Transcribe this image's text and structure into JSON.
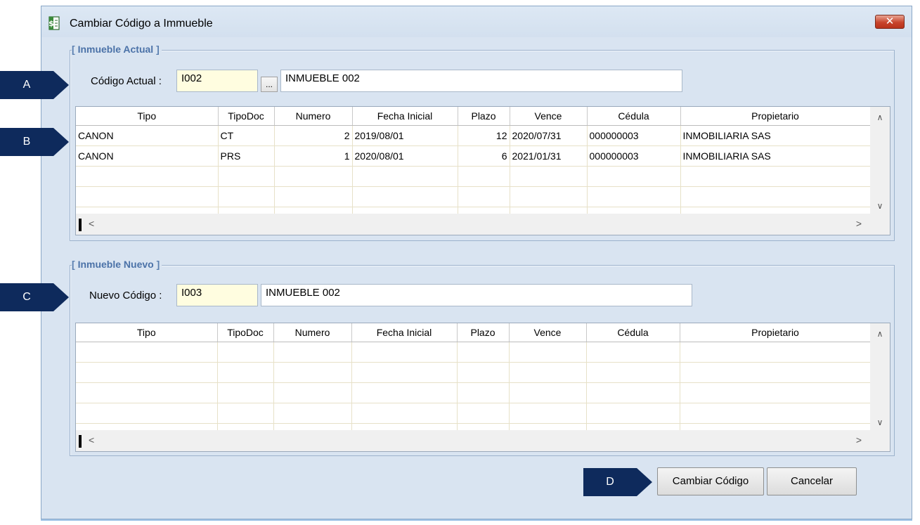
{
  "window": {
    "title": "Cambiar Código a Immueble",
    "close_glyph": "✕",
    "icon": "document-dollar-icon"
  },
  "current": {
    "group_title": "Inmueble Actual",
    "code_label": "Código Actual :",
    "code_value": "I002",
    "lookup_button": "...",
    "name_value": "INMUEBLE 002"
  },
  "new": {
    "group_title": "Inmueble Nuevo",
    "code_label": "Nuevo Código :",
    "code_value": "I003",
    "name_value": "INMUEBLE 002"
  },
  "grid_columns": [
    "Tipo",
    "TipoDoc",
    "Numero",
    "Fecha Inicial",
    "Plazo",
    "Vence",
    "Cédula",
    "Propietario"
  ],
  "current_rows": [
    [
      "CANON",
      "CT",
      "2",
      "2019/08/01",
      "12",
      "2020/07/31",
      "000000003",
      "INMOBILIARIA SAS"
    ],
    [
      "CANON",
      "PRS",
      "1",
      "2020/08/01",
      "6",
      "2021/01/31",
      "000000003",
      "INMOBILIARIA SAS"
    ]
  ],
  "buttons": {
    "change_code": "Cambiar Código",
    "cancel": "Cancelar"
  },
  "callouts": {
    "a": "A",
    "b": "B",
    "c": "C",
    "d": "D"
  },
  "colors": {
    "window_bg": "#d9e4f1",
    "callout_bg": "#0e2a5c",
    "group_title": "#4b72a8",
    "code_input_bg": "#fffde0"
  }
}
